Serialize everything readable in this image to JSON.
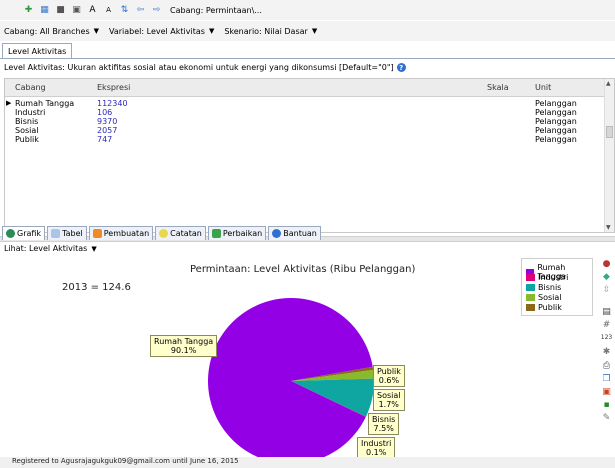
{
  "toolbar": {
    "breadcrumb": "Cabang: Permintaan\\..."
  },
  "selectors": {
    "cabang": "Cabang: All Branches",
    "variabel": "Variabel: Level Aktivitas",
    "skenario": "Skenario: Nilai Dasar"
  },
  "top_tab": "Level Aktivitas",
  "description": "Level Aktivitas: Ukuran aktifitas sosial atau ekonomi untuk energi yang dikonsumsi [Default=\"0\"]",
  "grid": {
    "headers": {
      "cabang": "Cabang",
      "ekspresi": "Ekspresi",
      "skala": "Skala",
      "unit": "Unit"
    },
    "rows": [
      {
        "cabang": "Rumah Tangga",
        "ekspresi": "112340",
        "unit": "Pelanggan"
      },
      {
        "cabang": "Industri",
        "ekspresi": "106",
        "unit": "Pelanggan"
      },
      {
        "cabang": "Bisnis",
        "ekspresi": "9370",
        "unit": "Pelanggan"
      },
      {
        "cabang": "Sosial",
        "ekspresi": "2057",
        "unit": "Pelanggan"
      },
      {
        "cabang": "Publik",
        "ekspresi": "747",
        "unit": "Pelanggan"
      }
    ]
  },
  "bottom_tabs": [
    "Grafik",
    "Tabel",
    "Pembuatan",
    "Catatan",
    "Perbaikan",
    "Bantuan"
  ],
  "lihat": "Lihat: Level Aktivitas",
  "chart_data": {
    "type": "pie",
    "title": "Permintaan: Level Aktivitas (Ribu Pelanggan)",
    "summary": "2013 = 124.6",
    "categories": [
      "Rumah Tangga",
      "Industri",
      "Bisnis",
      "Sosial",
      "Publik"
    ],
    "values": [
      90.1,
      0.1,
      7.5,
      1.7,
      0.6
    ],
    "labels": [
      "90.1%",
      "0.1%",
      "7.5%",
      "1.7%",
      "0.6%"
    ],
    "colors": [
      "#9400e6",
      "#e0007a",
      "#0fa5a0",
      "#8ab92d",
      "#8a6a1a"
    ],
    "legend_position": "top-right"
  },
  "sidebar_icons": [
    "paint-icon",
    "palette-icon",
    "scale-icon",
    "table-icon",
    "grid-icon",
    "num-icon",
    "chart-icon",
    "print-icon",
    "copy-icon",
    "export-icon",
    "save-icon",
    "wrench-icon"
  ],
  "status": "Registered to Agusrajagukguk09@gmail.com until June 16, 2015"
}
